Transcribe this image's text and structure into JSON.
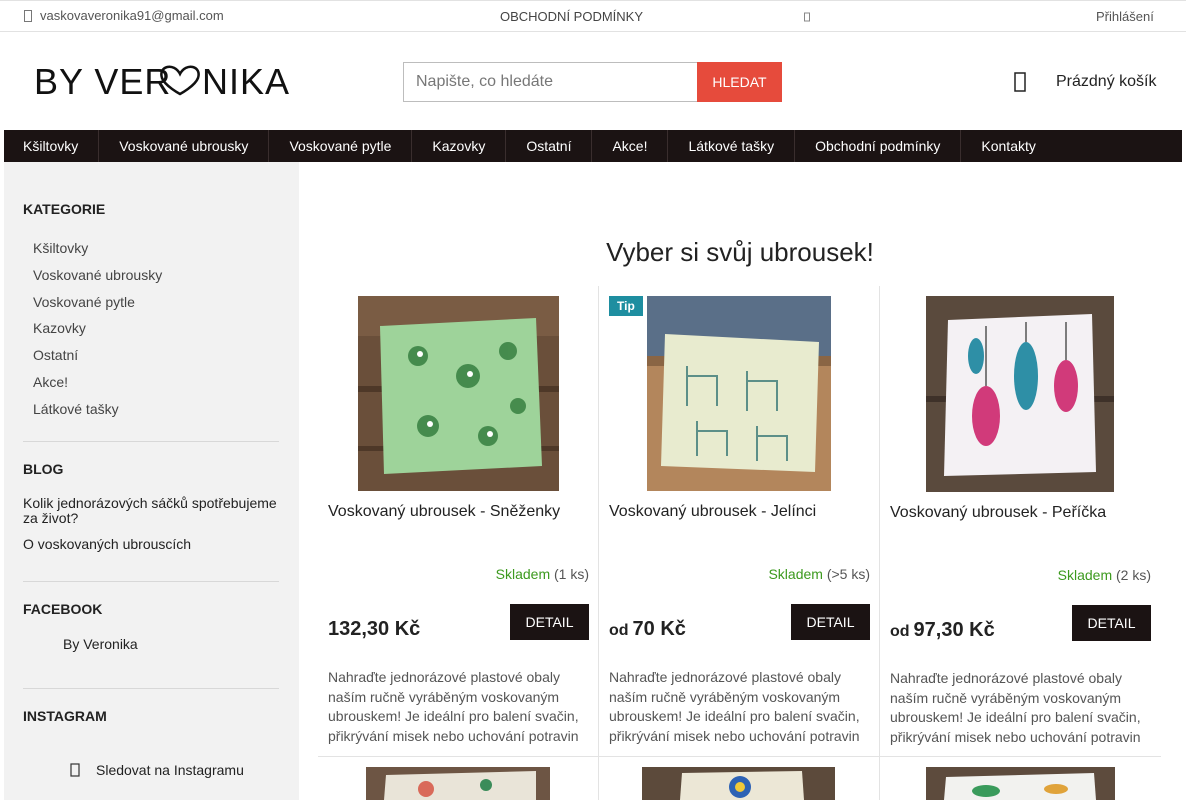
{
  "topbar": {
    "email": "vaskovaveronika91@gmail.com",
    "terms": "OBCHODNÍ PODMÍNKY",
    "login": "Přihlášení"
  },
  "header": {
    "logo_text": "BY VERONIKA",
    "search_placeholder": "Napište, co hledáte",
    "search_button": "HLEDAT",
    "cart_label": "Prázdný košík"
  },
  "nav": {
    "items": [
      "Kšiltovky",
      "Voskované ubrousky",
      "Voskované pytle",
      "Kazovky",
      "Ostatní",
      "Akce!",
      "Látkové tašky",
      "Obchodní podmínky",
      "Kontakty"
    ]
  },
  "sidebar": {
    "categories_title": "KATEGORIE",
    "categories": [
      "Kšiltovky",
      "Voskované ubrousky",
      "Voskované pytle",
      "Kazovky",
      "Ostatní",
      "Akce!",
      "Látkové tašky"
    ],
    "blog_title": "BLOG",
    "blog": [
      "Kolik jednorázových sáčků spotřebujeme za život?",
      "O voskovaných ubrouscích"
    ],
    "facebook_title": "FACEBOOK",
    "facebook_page": "By Veronika",
    "instagram_title": "INSTAGRAM",
    "instagram_link": "Sledovat na Instagramu"
  },
  "main": {
    "title": "Vyber si svůj ubrousek!",
    "products": [
      {
        "name": "Voskovaný ubrousek - Sněženky",
        "stock_status": "Skladem",
        "stock_count": "(1 ks)",
        "price_prefix": "",
        "price": "132,30 Kč",
        "detail_label": "DETAIL",
        "description": "Nahraďte jednorázové plastové obaly naším ručně vyráběným voskovaným ubrouskem! Je ideální pro balení svačin, přikrývání misek nebo uchování potravin",
        "badge": ""
      },
      {
        "name": "Voskovaný ubrousek - Jelínci",
        "stock_status": "Skladem",
        "stock_count": "(>5 ks)",
        "price_prefix": "od",
        "price": "70 Kč",
        "detail_label": "DETAIL",
        "description": "Nahraďte jednorázové plastové obaly naším ručně vyráběným voskovaným ubrouskem! Je ideální pro balení svačin, přikrývání misek nebo uchování potravin",
        "badge": "Tip"
      },
      {
        "name": "Voskovaný ubrousek - Peříčka",
        "stock_status": "Skladem",
        "stock_count": "(2 ks)",
        "price_prefix": "od",
        "price": "97,30 Kč",
        "detail_label": "DETAIL",
        "description": "Nahraďte jednorázové plastové obaly naším ručně vyráběným voskovaným ubrouskem! Je ideální pro balení svačin, přikrývání misek nebo uchování potravin",
        "badge": ""
      }
    ]
  },
  "colors": {
    "accent": "#e64b3c",
    "nav_bg": "#1b1313",
    "stock_green": "#3c9a1e",
    "tip_badge": "#1e8ea0"
  },
  "icons": {
    "email": "envelope-icon",
    "cart": "cart-icon",
    "instagram": "instagram-icon"
  }
}
